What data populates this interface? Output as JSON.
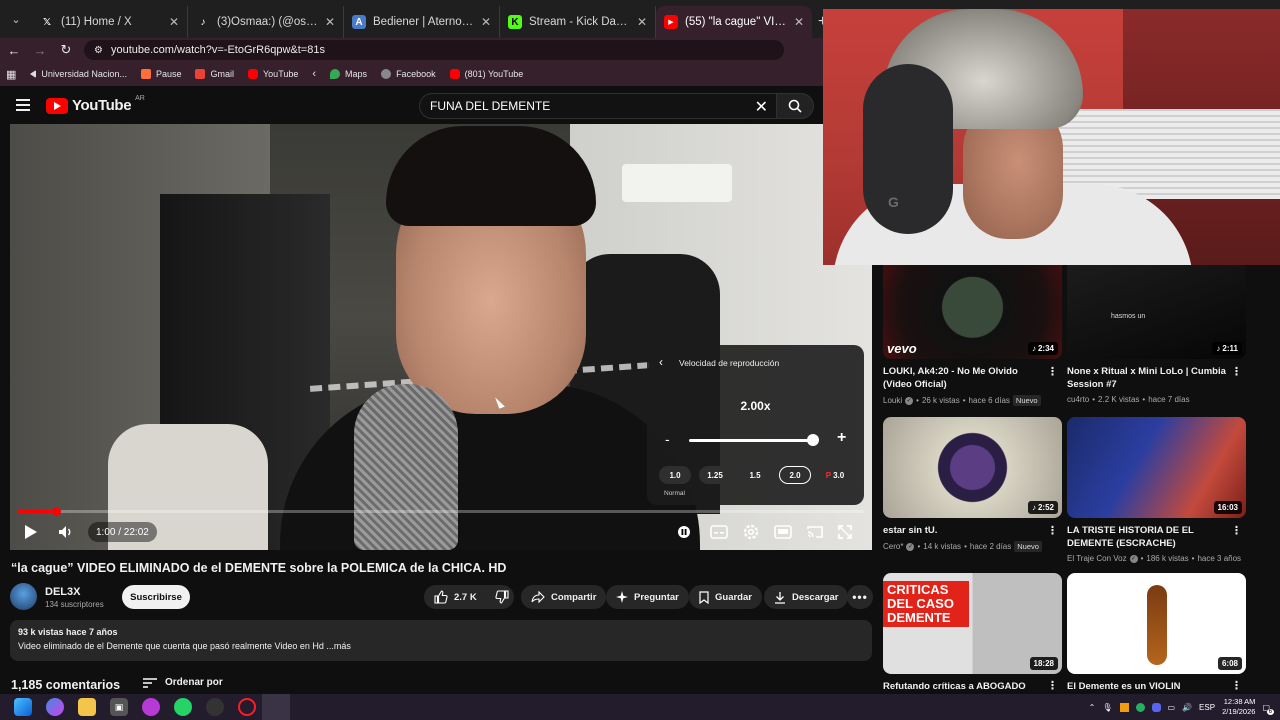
{
  "browser": {
    "tabs": [
      {
        "title": "(11) Home / X",
        "icon": "x-icon",
        "active": false
      },
      {
        "title": "(3)Osmaa:) (@osmavibes) | TikT",
        "icon": "tiktok-icon",
        "active": false
      },
      {
        "title": "Bediener | Aternos | Gratis Mine",
        "icon": "aternos-icon",
        "active": false
      },
      {
        "title": "Stream - Kick Dashboard",
        "icon": "kick-icon",
        "active": false
      },
      {
        "title": "(55) \"la cague\" VIDEO ELIMINAD",
        "icon": "youtube-icon",
        "active": true
      }
    ],
    "url": "youtube.com/watch?v=-EtoGrR6qpw&t=81s",
    "bookmarks": [
      {
        "label": "Universidad Nacion...",
        "icon": "folder-icon",
        "color": "#7aa3d6"
      },
      {
        "label": "Pause",
        "icon": "pause-icon",
        "color": "#ff6f3c"
      },
      {
        "label": "Gmail",
        "icon": "gmail-icon",
        "color": "#ea4335"
      },
      {
        "label": "YouTube",
        "icon": "youtube-icon",
        "color": "#ff0000"
      },
      {
        "label": "",
        "icon": "chevron-left-icon",
        "color": "#cccccc"
      },
      {
        "label": "Maps",
        "icon": "maps-icon",
        "color": "#34a853"
      },
      {
        "label": "Facebook",
        "icon": "globe-icon",
        "color": "#aaaaaa"
      },
      {
        "label": "(801) YouTube",
        "icon": "youtube-icon",
        "color": "#ff0000"
      }
    ]
  },
  "youtube": {
    "logo_text": "YouTube",
    "country": "AR",
    "search_value": "FUNA DEL DEMENTE"
  },
  "player": {
    "speed_menu": {
      "title": "Velocidad de reproducción",
      "value": "2.00x",
      "presets": [
        "1.0",
        "1.25",
        "1.5",
        "2.0",
        "3.0"
      ],
      "selected": "2.0",
      "normal_label": "Normal",
      "speed_fraction": 0.95
    },
    "time": "1:00 / 22:02",
    "progress": 0.045
  },
  "video": {
    "title": "“la cague” VIDEO ELIMINADO de el DEMENTE sobre la POLEMICA de la CHICA. HD",
    "channel": "DEL3X",
    "subscribers": "134 suscriptores",
    "subscribe_label": "Suscribirse",
    "likes": "2.7 K",
    "share_label": "Compartir",
    "ask_label": "Preguntar",
    "save_label": "Guardar",
    "download_label": "Descargar",
    "views_date": "93 k vistas  hace 7 años",
    "description": "Video eliminado de el Demente que cuenta que pasó realmente Video en Hd ...más",
    "comments_count": "1,185 comentarios",
    "sort_label": "Ordenar por"
  },
  "recommendations": [
    {
      "title": "LOUKI, Ak4:20 - No Me Olvido (Video Oficial)",
      "channel": "Louki",
      "verified": true,
      "views": "26 k vistas",
      "age": "hace 6 días",
      "badge": "Nuevo",
      "duration": "2:34"
    },
    {
      "title": "None x Ritual x Mini LoLo | Cumbia Session #7",
      "channel": "cu4rto",
      "verified": false,
      "views": "2.2 K vistas",
      "age": "hace 7 días",
      "badge": "",
      "duration": "2:11"
    },
    {
      "title": "estar sin tU.",
      "channel": "Cero*",
      "verified": true,
      "views": "14 k vistas",
      "age": "hace 2 días",
      "badge": "Nuevo",
      "duration": "2:52"
    },
    {
      "title": "LA TRISTE HISTORIA DE EL DEMENTE (ESCRACHE)",
      "channel": "El Traje Con Voz",
      "verified": true,
      "views": "186 k vistas",
      "age": "hace 3 años",
      "badge": "",
      "duration": "16:03"
    },
    {
      "title": "Refutando críticas a ABOGADO",
      "duration": "18:28",
      "thumb_text": "CRITICAS DEL CASO DEMENTE"
    },
    {
      "title": "El Demente es un VIOLIN",
      "duration": "6:08"
    }
  ],
  "thumb_texts": {
    "vevo": "vevo",
    "hasmos": "hasmos un"
  },
  "taskbar": {
    "time": "12:38 AM",
    "date": "2/19/2026",
    "lang": "ESP",
    "notifications": "6"
  },
  "colors": {
    "youtube_red": "#ff0000",
    "browser_accent": "#35202c"
  }
}
